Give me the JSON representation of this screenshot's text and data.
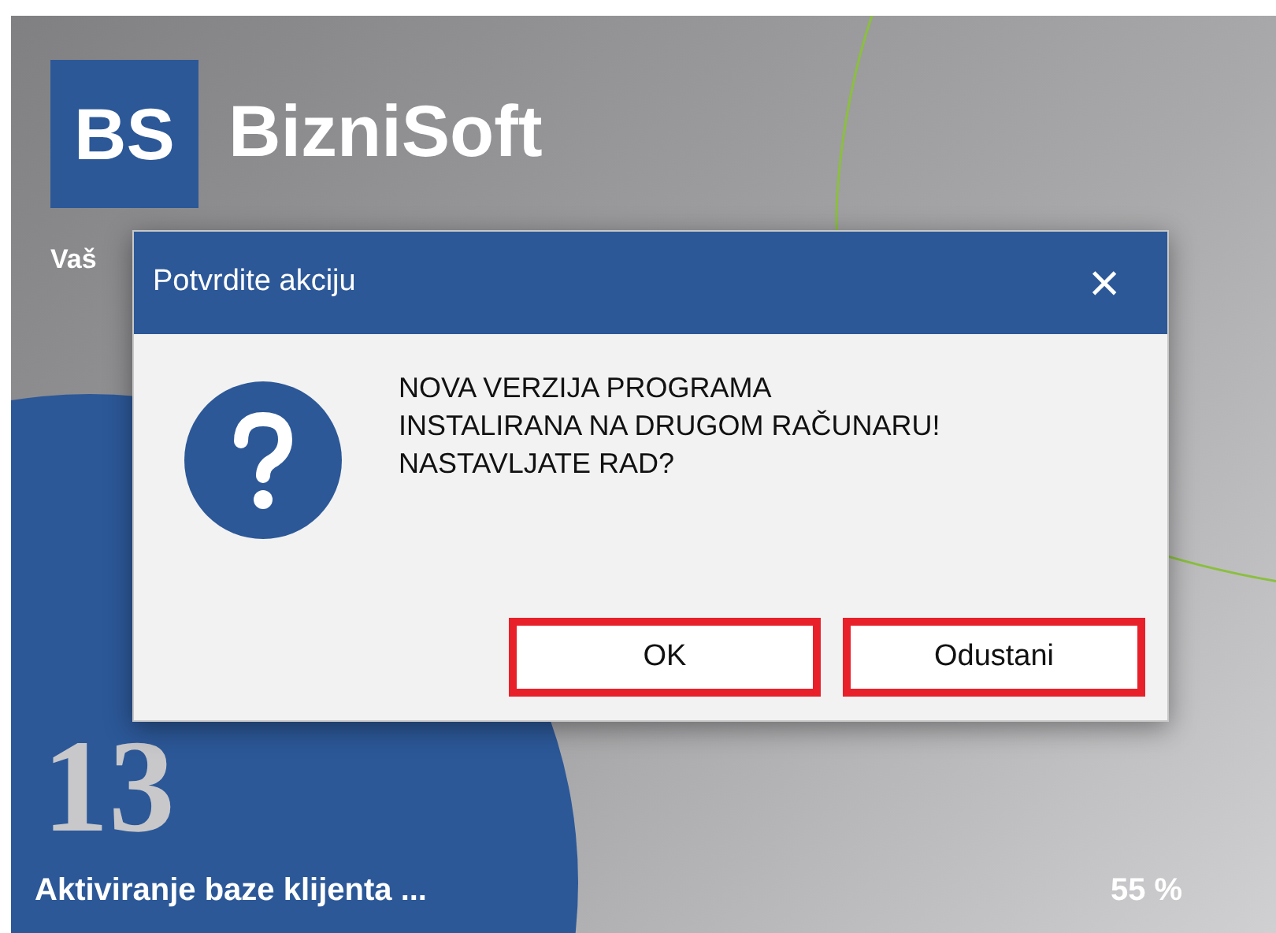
{
  "splash": {
    "logo_mark": "BS",
    "logo_text": "BizniSoft",
    "tagline": "Vaš",
    "version": "13",
    "status": "Aktiviranje baze klijenta ...",
    "percent": "55 %"
  },
  "dialog": {
    "title": "Potvrdite akciju",
    "close": "×",
    "message": [
      "NOVA VERZIJA PROGRAMA",
      "INSTALIRANA NA DRUGOM RAČUNARU!",
      "NASTAVLJATE RAD?"
    ],
    "buttons": [
      {
        "label": "OK",
        "highlighted": true
      },
      {
        "label": "Odustani",
        "highlighted": true
      }
    ]
  }
}
